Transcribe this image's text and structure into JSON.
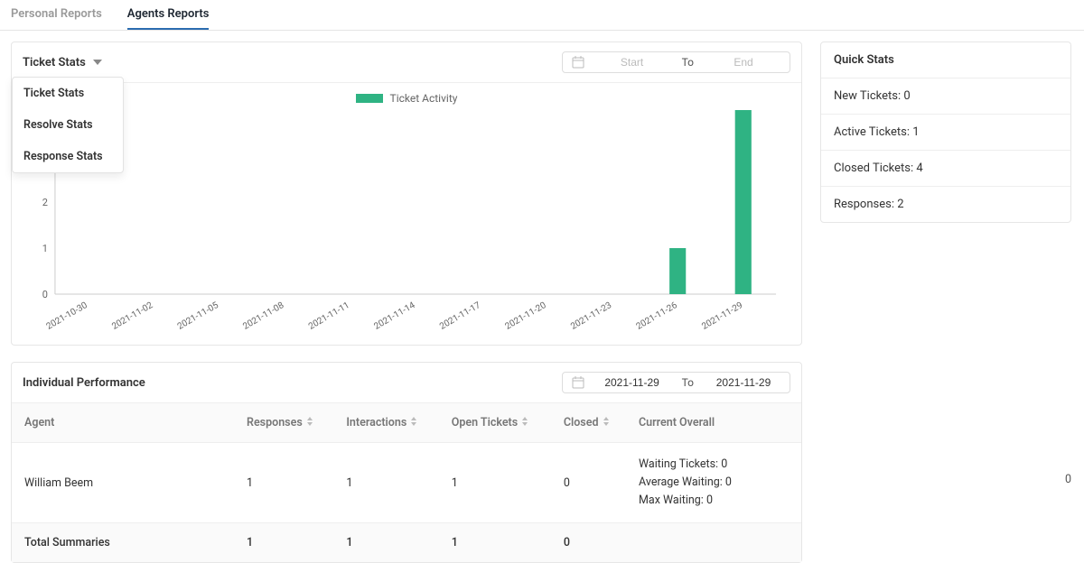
{
  "tabs": {
    "personal": "Personal Reports",
    "agents": "Agents Reports"
  },
  "dropdown": {
    "label": "Ticket Stats",
    "options": [
      "Ticket Stats",
      "Resolve Stats",
      "Response Stats"
    ]
  },
  "date_range_top": {
    "start_placeholder": "Start",
    "to": "To",
    "end_placeholder": "End"
  },
  "date_range_perf": {
    "start_value": "2021-11-29",
    "to": "To",
    "end_value": "2021-11-29"
  },
  "chart_data": {
    "type": "bar",
    "title": "Ticket Activity",
    "legend": [
      "Ticket Activity"
    ],
    "categories": [
      "2021-10-30",
      "2021-11-02",
      "2021-11-05",
      "2021-11-08",
      "2021-11-11",
      "2021-11-14",
      "2021-11-17",
      "2021-11-20",
      "2021-11-23",
      "2021-11-26",
      "2021-11-29"
    ],
    "values": [
      0,
      0,
      0,
      0,
      0,
      0,
      0,
      0,
      0,
      1,
      4
    ],
    "y_ticks": [
      0,
      1,
      2
    ],
    "ylim": [
      0,
      4
    ]
  },
  "quick_stats": {
    "title": "Quick Stats",
    "new_label": "New Tickets:",
    "new_value": "0",
    "active_label": "Active Tickets:",
    "active_value": "1",
    "closed_label": "Closed Tickets:",
    "closed_value": "4",
    "resp_label": "Responses:",
    "resp_value": "2"
  },
  "perf": {
    "title": "Individual Performance",
    "columns": {
      "agent": "Agent",
      "responses": "Responses",
      "interactions": "Interactions",
      "open": "Open Tickets",
      "closed": "Closed",
      "overall": "Current Overall"
    },
    "row": {
      "agent": "William Beem",
      "responses": "1",
      "interactions": "1",
      "open": "1",
      "closed": "0",
      "overall_waiting_label": "Waiting Tickets:",
      "overall_waiting_val": "0",
      "overall_avg_label": "Average Waiting:",
      "overall_avg_val": "0",
      "overall_max_label": "Max Waiting:",
      "overall_max_val": "0"
    },
    "totals": {
      "label": "Total Summaries",
      "responses": "1",
      "interactions": "1",
      "open": "1",
      "closed": "0"
    },
    "scroll_badge": "0"
  }
}
